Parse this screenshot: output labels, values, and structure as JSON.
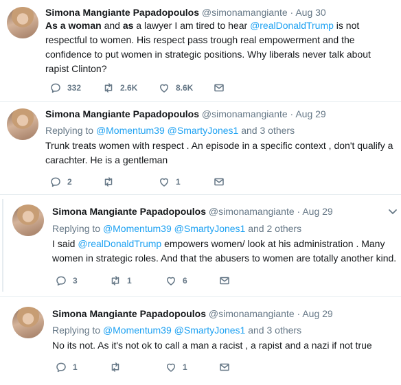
{
  "tweets": [
    {
      "name": "Simona Mangiante Papadopoulos",
      "handle": "@simonamangiante",
      "dot": "·",
      "date": "Aug 30",
      "body": {
        "t1": "As a woman",
        "t2": " and ",
        "t3": "as",
        "t4": " a lawyer I am tired to hear ",
        "mention": "@realDonaldTrump",
        "t5": " is not respectful to women. His respect pass trough real empowerment and the confidence to put women in strategic positions. Why liberals never talk about rapist Clinton?"
      },
      "counts": {
        "replies": "332",
        "retweets": "2.6K",
        "likes": "8.6K"
      }
    },
    {
      "name": "Simona Mangiante Papadopoulos",
      "handle": "@simonamangiante",
      "dot": "·",
      "date": "Aug 29",
      "reply": {
        "prefix": "Replying to ",
        "m1": "@Momentum39",
        "m2": "@SmartyJones1",
        "and": " and ",
        "others": "3 others"
      },
      "body": {
        "text": "Trunk treats women with respect . An episode in a specific context , don't qualify a carachter. He is a gentleman"
      },
      "counts": {
        "replies": "2",
        "retweets": "",
        "likes": "1"
      }
    },
    {
      "name": "Simona Mangiante Papadopoulos",
      "handle": "@simonamangiante",
      "dot": "·",
      "date": "Aug 29",
      "reply": {
        "prefix": "Replying to ",
        "m1": "@Momentum39",
        "m2": "@SmartyJones1",
        "and": " and ",
        "others": "2 others"
      },
      "body": {
        "t1": "I said ",
        "mention": "@realDonaldTrump",
        "t2": " empowers women/ look at his administration . Many women in strategic roles. And that the abusers to women are totally another kind."
      },
      "counts": {
        "replies": "3",
        "retweets": "1",
        "likes": "6"
      }
    },
    {
      "name": "Simona Mangiante Papadopoulos",
      "handle": "@simonamangiante",
      "dot": "·",
      "date": "Aug 29",
      "reply": {
        "prefix": "Replying to ",
        "m1": "@Momentum39",
        "m2": "@SmartyJones1",
        "and": " and ",
        "others": "3 others"
      },
      "body": {
        "text": "No its not. As it's not ok to call a man a racist , a rapist and a nazi if not true"
      },
      "counts": {
        "replies": "1",
        "retweets": "",
        "likes": "1"
      }
    }
  ],
  "icons": {
    "reply": "reply-icon",
    "retweet": "retweet-icon",
    "like": "heart-icon",
    "dm": "envelope-icon",
    "caret": "chevron-down-icon"
  },
  "colors": {
    "link": "#1da1f2",
    "muted": "#657786",
    "text": "#14171a",
    "divider": "#e6ecf0"
  }
}
